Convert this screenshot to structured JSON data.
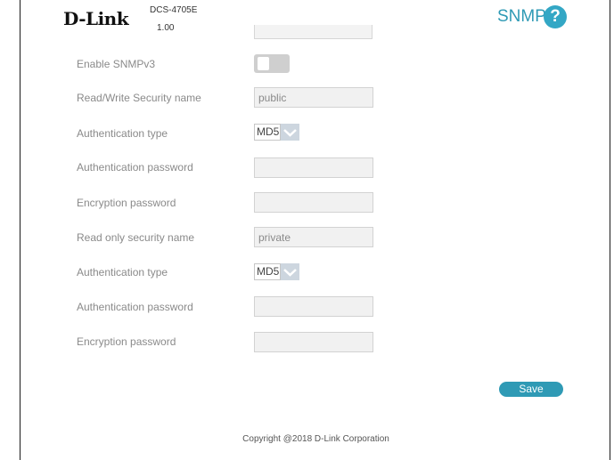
{
  "header": {
    "logo": "D-Link",
    "model": "DCS-4705E",
    "firmware": "1.00",
    "page_title": "SNMP",
    "help_icon": "?"
  },
  "form": {
    "enable_snmpv3_label": "Enable SNMPv3",
    "enable_snmpv3_on": false,
    "rw_security_name_label": "Read/Write Security name",
    "rw_security_name_value": "public",
    "rw_auth_type_label": "Authentication type",
    "rw_auth_type_value": "MD5",
    "rw_auth_password_label": "Authentication password",
    "rw_encryption_password_label": "Encryption password",
    "ro_security_name_label": "Read only security name",
    "ro_security_name_value": "private",
    "ro_auth_type_label": "Authentication type",
    "ro_auth_type_value": "MD5",
    "ro_auth_password_label": "Authentication password",
    "ro_encryption_password_label": "Encryption password"
  },
  "actions": {
    "save_label": "Save"
  },
  "footer": {
    "copyright": "Copyright @2018 D-Link Corporation"
  },
  "colors": {
    "accent": "#2f9ab5",
    "label": "#8a8a8a"
  }
}
